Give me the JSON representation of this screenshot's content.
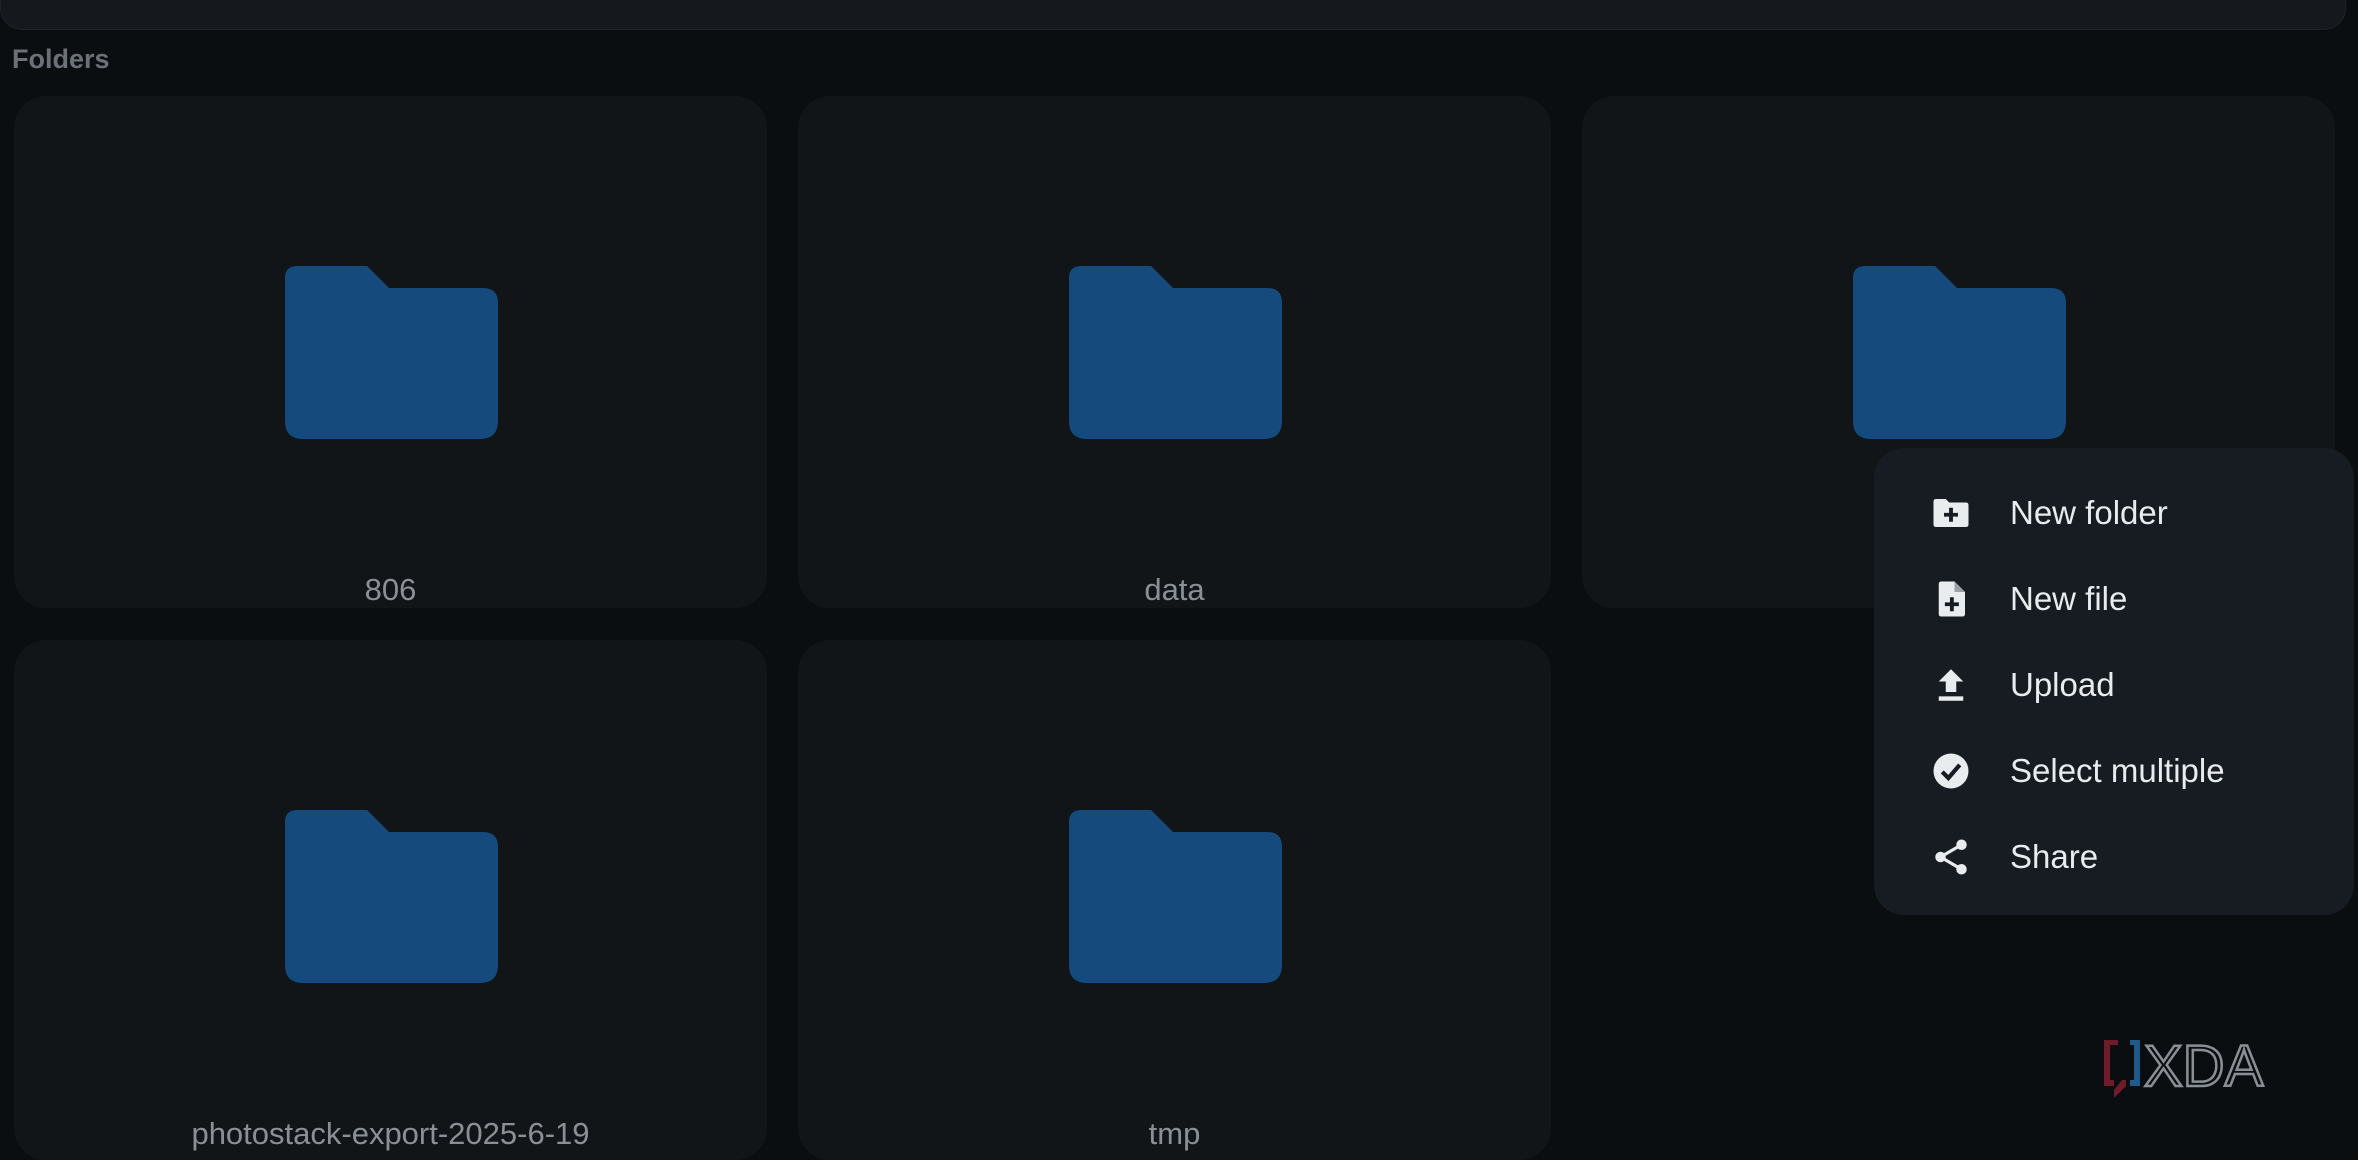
{
  "section": {
    "title": "Folders"
  },
  "folders": [
    {
      "name": "806"
    },
    {
      "name": "data"
    },
    {
      "name": ""
    },
    {
      "name": "photostack-export-2025-6-19"
    },
    {
      "name": "tmp"
    }
  ],
  "context_menu": {
    "items": [
      {
        "label": "New folder",
        "icon": "new-folder-icon"
      },
      {
        "label": "New file",
        "icon": "new-file-icon"
      },
      {
        "label": "Upload",
        "icon": "upload-icon"
      },
      {
        "label": "Select multiple",
        "icon": "check-circle-icon"
      },
      {
        "label": "Share",
        "icon": "share-icon"
      }
    ]
  },
  "watermark": {
    "text": "XDA"
  },
  "colors": {
    "background": "#0b0e11",
    "card": "#121518",
    "folder": "#144a7c",
    "menu": "#161c22"
  }
}
